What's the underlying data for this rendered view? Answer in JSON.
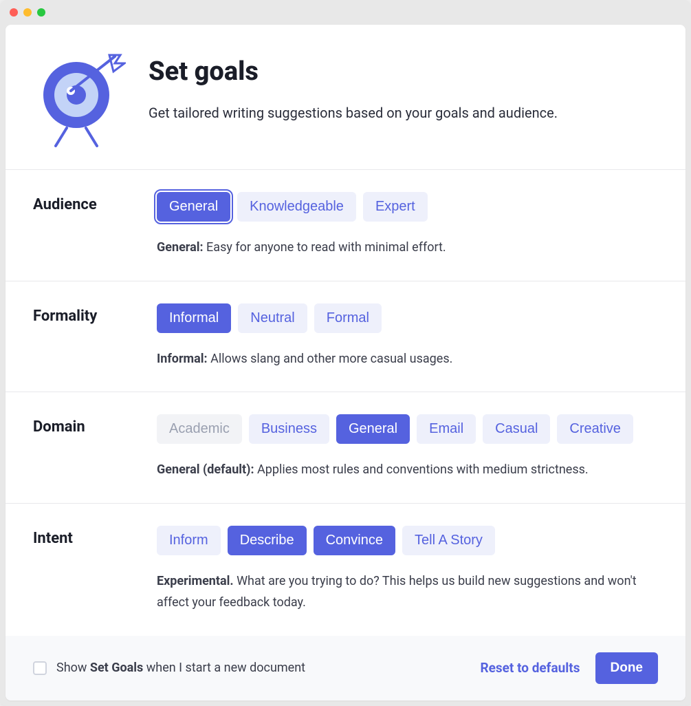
{
  "header": {
    "title": "Set goals",
    "subtitle": "Get tailored writing suggestions based on your goals and audience."
  },
  "sections": {
    "audience": {
      "label": "Audience",
      "options": [
        "General",
        "Knowledgeable",
        "Expert"
      ],
      "selected": "General",
      "focused": "General",
      "desc_strong": "General:",
      "desc_rest": " Easy for anyone to read with minimal effort."
    },
    "formality": {
      "label": "Formality",
      "options": [
        "Informal",
        "Neutral",
        "Formal"
      ],
      "selected": "Informal",
      "desc_strong": "Informal:",
      "desc_rest": " Allows slang and other more casual usages."
    },
    "domain": {
      "label": "Domain",
      "options": [
        "Academic",
        "Business",
        "General",
        "Email",
        "Casual",
        "Creative"
      ],
      "selected": "General",
      "disabled": [
        "Academic"
      ],
      "desc_strong": "General (default):",
      "desc_rest": " Applies most rules and conventions with medium strictness."
    },
    "intent": {
      "label": "Intent",
      "options": [
        "Inform",
        "Describe",
        "Convince",
        "Tell A Story"
      ],
      "selected_multi": [
        "Describe",
        "Convince"
      ],
      "desc_strong": "Experimental.",
      "desc_rest": " What are you trying to do? This helps us build new suggestions and won't affect your feedback today."
    }
  },
  "footer": {
    "checkbox_checked": false,
    "show_pre": "Show ",
    "show_strong": "Set Goals",
    "show_post": " when I start a new document",
    "reset_label": "Reset to defaults",
    "done_label": "Done"
  }
}
